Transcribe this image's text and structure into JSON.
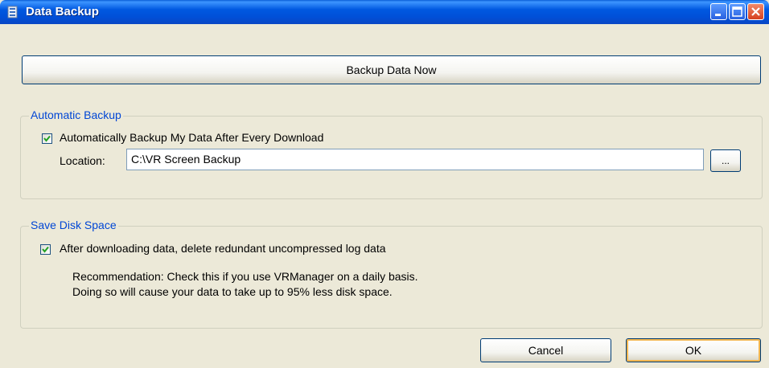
{
  "window": {
    "title": "Data Backup",
    "titlebar_color": "#0054e3"
  },
  "backup_now": {
    "label": "Backup Data Now"
  },
  "automatic_backup": {
    "legend": "Automatic Backup",
    "checkbox_label": "Automatically Backup My Data After Every Download",
    "checked": true,
    "location_label": "Location:",
    "location_value": "C:\\VR Screen Backup",
    "browse_label": "..."
  },
  "save_disk_space": {
    "legend": "Save Disk Space",
    "checkbox_label": "After downloading data, delete redundant uncompressed log data",
    "checked": true,
    "recommendation_line1": "Recommendation:  Check this if you use VRManager on a daily basis.",
    "recommendation_line2": "Doing so will cause your data to take up to 95% less disk space."
  },
  "footer": {
    "cancel_label": "Cancel",
    "ok_label": "OK"
  },
  "icons": {
    "app": "app-document-icon",
    "minimize": "minimize-icon",
    "maximize": "maximize-icon",
    "close": "close-icon",
    "check": "checkmark-icon"
  }
}
